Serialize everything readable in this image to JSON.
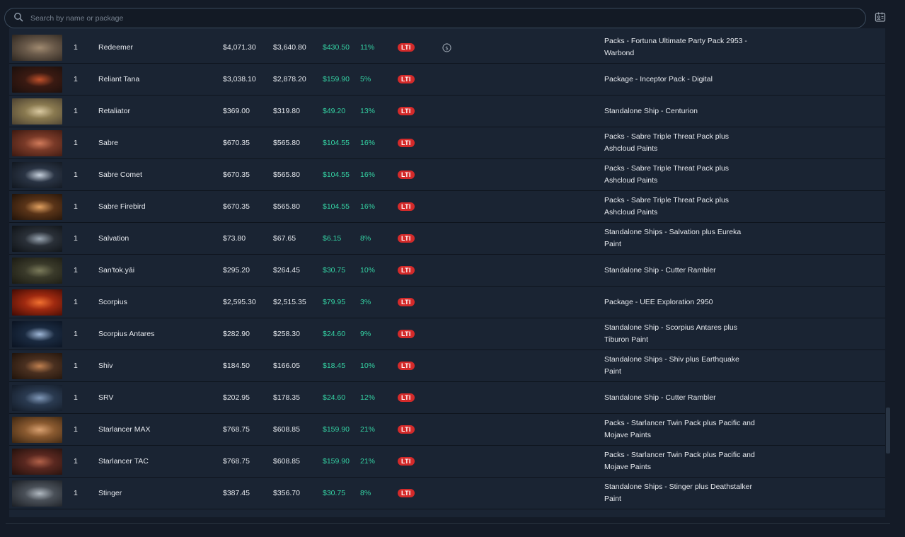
{
  "search": {
    "placeholder": "Search by name or package",
    "value": ""
  },
  "icons": {
    "search": "search-icon",
    "id_card": "id-card-icon",
    "coin": "dollar-coin-icon"
  },
  "colors": {
    "savings": "#34d2a3",
    "lti_badge": "#d42a2a",
    "background": "#141b27",
    "row_bg": "#1a2433"
  },
  "rows": [
    {
      "qty": "1",
      "name": "Redeemer",
      "price": "$4,071.30",
      "melt": "$3,640.80",
      "savings": "$430.50",
      "pct": "11%",
      "lti": "LTI",
      "coin": true,
      "source": "Packs - Fortuna Ultimate Party Pack 2953 - Warbond",
      "thumb": [
        "#6a5a4a",
        "#a08a70",
        "#2d2620"
      ]
    },
    {
      "qty": "1",
      "name": "Reliant Tana",
      "price": "$3,038.10",
      "melt": "$2,878.20",
      "savings": "$159.90",
      "pct": "5%",
      "lti": "LTI",
      "coin": false,
      "source": "Package - Inceptor Pack - Digital",
      "thumb": [
        "#3a1a12",
        "#c0502a",
        "#1a0f0c"
      ]
    },
    {
      "qty": "1",
      "name": "Retaliator",
      "price": "$369.00",
      "melt": "$319.80",
      "savings": "$49.20",
      "pct": "13%",
      "lti": "LTI",
      "coin": false,
      "source": "Standalone Ship - Centurion",
      "thumb": [
        "#8a7a50",
        "#d8c8a0",
        "#4a4030"
      ]
    },
    {
      "qty": "1",
      "name": "Sabre",
      "price": "$670.35",
      "melt": "$565.80",
      "savings": "$104.55",
      "pct": "16%",
      "lti": "LTI",
      "coin": false,
      "source": "Packs - Sabre Triple Threat Pack plus Ashcloud Paints",
      "thumb": [
        "#7a3a28",
        "#d07a5a",
        "#3a1810"
      ]
    },
    {
      "qty": "1",
      "name": "Sabre Comet",
      "price": "$670.35",
      "melt": "$565.80",
      "savings": "$104.55",
      "pct": "16%",
      "lti": "LTI",
      "coin": false,
      "source": "Packs - Sabre Triple Threat Pack plus Ashcloud Paints",
      "thumb": [
        "#2a3444",
        "#c8d2de",
        "#10161e"
      ]
    },
    {
      "qty": "1",
      "name": "Sabre Firebird",
      "price": "$670.35",
      "melt": "$565.80",
      "savings": "$104.55",
      "pct": "16%",
      "lti": "LTI",
      "coin": false,
      "source": "Packs - Sabre Triple Threat Pack plus Ashcloud Paints",
      "thumb": [
        "#5a3418",
        "#e0a060",
        "#201208"
      ]
    },
    {
      "qty": "1",
      "name": "Salvation",
      "price": "$73.80",
      "melt": "$67.65",
      "savings": "$6.15",
      "pct": "8%",
      "lti": "LTI",
      "coin": false,
      "source": "Standalone Ships - Salvation plus Eureka Paint",
      "thumb": [
        "#2a3038",
        "#9aa6b2",
        "#0e1216"
      ]
    },
    {
      "qty": "1",
      "name": "San'tok.yāi",
      "price": "$295.20",
      "melt": "$264.45",
      "savings": "$30.75",
      "pct": "10%",
      "lti": "LTI",
      "coin": false,
      "source": "Standalone Ship - Cutter Rambler",
      "thumb": [
        "#3a3a2a",
        "#7a7a5a",
        "#1a1a12"
      ]
    },
    {
      "qty": "1",
      "name": "Scorpius",
      "price": "$2,595.30",
      "melt": "$2,515.35",
      "savings": "$79.95",
      "pct": "3%",
      "lti": "LTI",
      "coin": false,
      "source": "Package - UEE Exploration 2950",
      "thumb": [
        "#a02a10",
        "#f07030",
        "#400a04"
      ]
    },
    {
      "qty": "1",
      "name": "Scorpius Antares",
      "price": "$282.90",
      "melt": "$258.30",
      "savings": "$24.60",
      "pct": "9%",
      "lti": "LTI",
      "coin": false,
      "source": "Standalone Ship - Scorpius Antares plus Tiburon Paint",
      "thumb": [
        "#1a2a40",
        "#a0b8d8",
        "#0a1220"
      ]
    },
    {
      "qty": "1",
      "name": "Shiv",
      "price": "$184.50",
      "melt": "$166.05",
      "savings": "$18.45",
      "pct": "10%",
      "lti": "LTI",
      "coin": false,
      "source": "Standalone Ships - Shiv plus Earthquake Paint",
      "thumb": [
        "#4a3020",
        "#c08050",
        "#1e120a"
      ]
    },
    {
      "qty": "1",
      "name": "SRV",
      "price": "$202.95",
      "melt": "$178.35",
      "savings": "$24.60",
      "pct": "12%",
      "lti": "LTI",
      "coin": false,
      "source": "Standalone Ship - Cutter Rambler",
      "thumb": [
        "#2a3a50",
        "#8098b8",
        "#121a26"
      ]
    },
    {
      "qty": "1",
      "name": "Starlancer MAX",
      "price": "$768.75",
      "melt": "$608.85",
      "savings": "$159.90",
      "pct": "21%",
      "lti": "LTI",
      "coin": false,
      "source": "Packs - Starlancer Twin Pack plus Pacific and Mojave Paints",
      "thumb": [
        "#8a5a30",
        "#d8a070",
        "#3a2410"
      ]
    },
    {
      "qty": "1",
      "name": "Starlancer TAC",
      "price": "$768.75",
      "melt": "$608.85",
      "savings": "$159.90",
      "pct": "21%",
      "lti": "LTI",
      "coin": false,
      "source": "Packs - Starlancer Twin Pack plus Pacific and Mojave Paints",
      "thumb": [
        "#5a2820",
        "#b06048",
        "#22100c"
      ]
    },
    {
      "qty": "1",
      "name": "Stinger",
      "price": "$387.45",
      "melt": "$356.70",
      "savings": "$30.75",
      "pct": "8%",
      "lti": "LTI",
      "coin": false,
      "source": "Standalone Ships - Stinger plus Deathstalker Paint",
      "thumb": [
        "#4a5058",
        "#b0b8c0",
        "#1a1e24"
      ]
    }
  ]
}
